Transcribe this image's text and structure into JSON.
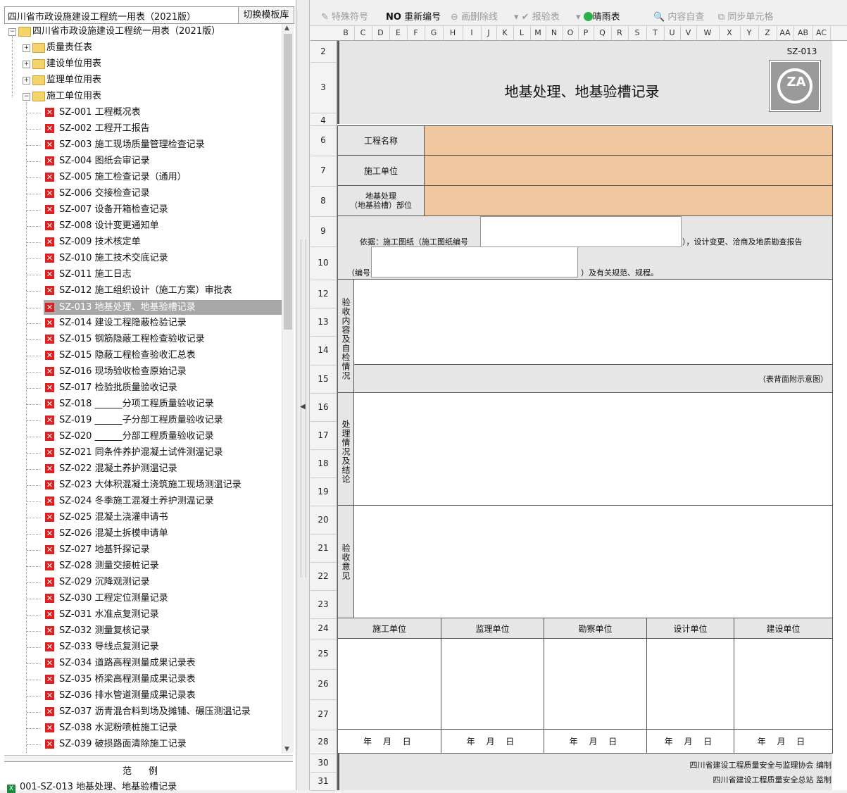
{
  "left_panel": {
    "selector_value": "四川省市政设施建设工程统一用表（2021版）",
    "switch_button": "切换模板库",
    "root": "四川省市政设施建设工程统一用表（2021版）",
    "folders": [
      "质量责任表",
      "建设单位用表",
      "监理单位用表",
      "施工单位用表"
    ],
    "items": [
      "SZ-001 工程概况表",
      "SZ-002 工程开工报告",
      "SZ-003 施工现场质量管理检查记录",
      "SZ-004 图纸会审记录",
      "SZ-005 施工检查记录（通用）",
      "SZ-006 交接检查记录",
      "SZ-007 设备开箱检查记录",
      "SZ-008 设计变更通知单",
      "SZ-009 技术核定单",
      "SZ-010 施工技术交底记录",
      "SZ-011 施工日志",
      "SZ-012 施工组织设计（施工方案）审批表",
      "SZ-013 地基处理、地基验槽记录",
      "SZ-014 建设工程隐蔽检验记录",
      "SZ-015 钢筋隐蔽工程检查验收记录",
      "SZ-015 隐蔽工程检查验收汇总表",
      "SZ-016 现场验收检查原始记录",
      "SZ-017 检验批质量验收记录",
      "SZ-018 ______分项工程质量验收记录",
      "SZ-019 ______子分部工程质量验收记录",
      "SZ-020 ______分部工程质量验收记录",
      "SZ-021 同条件养护混凝土试件测温记录",
      "SZ-022 混凝土养护测温记录",
      "SZ-023 大体积混凝土浇筑施工现场测温记录",
      "SZ-024 冬季施工混凝土养护测温记录",
      "SZ-025 混凝土浇灌申请书",
      "SZ-026 混凝土拆模申请单",
      "SZ-027 地基钎探记录",
      "SZ-028 测量交接桩记录",
      "SZ-029 沉降观测记录",
      "SZ-030 工程定位测量记录",
      "SZ-031 水准点复测记录",
      "SZ-032 测量复核记录",
      "SZ-033 导线点复测记录",
      "SZ-034 道路高程测量成果记录表",
      "SZ-035 桥梁高程测量成果记录表",
      "SZ-036 排水管道测量成果记录表",
      "SZ-037 沥青混合料到场及摊铺、碾压测温记录",
      "SZ-038 水泥粉喷桩施工记录",
      "SZ-039 破损路面清除施工记录"
    ],
    "selected_index": 12,
    "examples_header": "范例",
    "example_item": "001-SZ-013 地基处理、地基验槽记录"
  },
  "toolbar": {
    "special_symbol": "特殊符号",
    "renumber": "重新编号",
    "strike": "画删除线",
    "report": "报验表",
    "weather": "晴雨表",
    "self_check": "内容自查",
    "sync": "同步单元格"
  },
  "columns": [
    "B",
    "C",
    "D",
    "E",
    "F",
    "G",
    "H",
    "I",
    "J",
    "K",
    "L",
    "M",
    "N",
    "O",
    "P",
    "Q",
    "R",
    "S",
    "T",
    "U",
    "V",
    "W",
    "X",
    "Y",
    "Z",
    "AA",
    "AB",
    "AC"
  ],
  "rows": [
    "2",
    "3",
    "4",
    "6",
    "7",
    "8",
    "9",
    "10",
    "12",
    "13",
    "14",
    "15",
    "16",
    "17",
    "18",
    "19",
    "20",
    "21",
    "22",
    "23",
    "24",
    "25",
    "26",
    "27",
    "28",
    "30",
    "31"
  ],
  "form": {
    "code": "SZ-013",
    "title": "地基处理、地基验槽记录",
    "logo_text": "ZA",
    "project_name_label": "工程名称",
    "construction_unit_label": "施工单位",
    "location_label_1": "地基处理",
    "location_label_2": "（地基验槽）部位",
    "basis_prefix": "依据：施工图纸（施工图纸编号",
    "basis_suffix": "），设计变更、洽商及地质勘查报告",
    "number_prefix": "（编号",
    "number_suffix": "）及有关规范、规程。",
    "section_inspection": "验收内容及自检情况",
    "back_note": "（表背面附示意图）",
    "section_treatment": "处理情况及结论",
    "section_opinion": "验收意见",
    "sign_units": [
      "施工单位",
      "监理单位",
      "勘察单位",
      "设计单位",
      "建设单位"
    ],
    "date_text": "年 月 日",
    "footer_1": "四川省建设工程质量安全与监理协会 编制",
    "footer_2": "四川省建设工程质量安全总站 监制"
  }
}
